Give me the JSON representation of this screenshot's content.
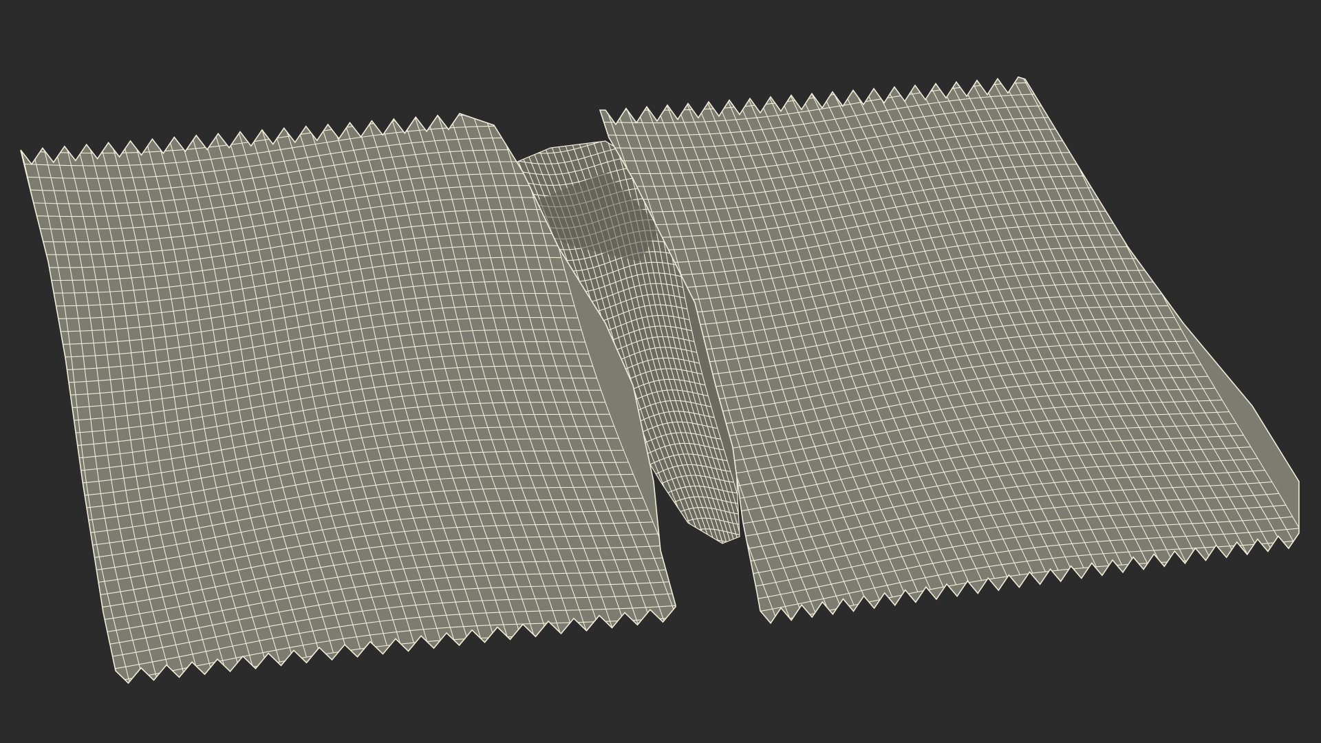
{
  "scene": {
    "background_color": "#2b2b2b",
    "surface_color": "#7c7c70",
    "surface_shadow_color": "#5f5f56",
    "interior_color": "#6b6b62",
    "wire_color": "#f2eedc",
    "subject": "torn-wrapper-wireframe"
  }
}
